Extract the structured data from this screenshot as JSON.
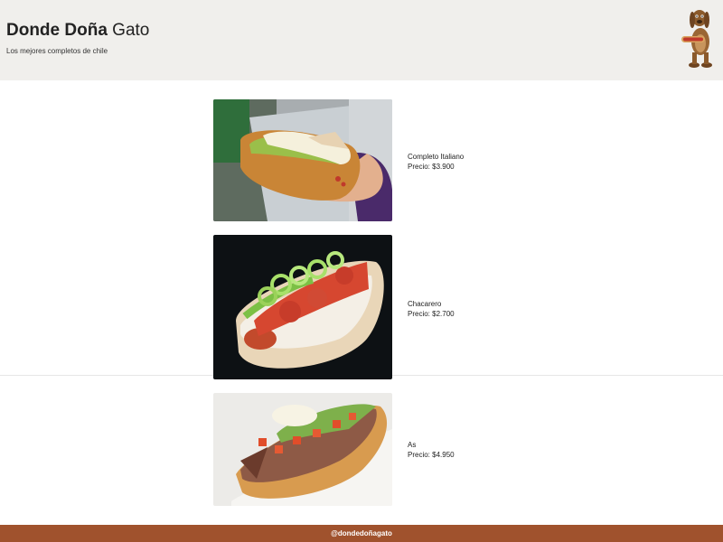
{
  "header": {
    "title_bold": "Donde Doña",
    "title_regular": "Gato",
    "tagline": "Los mejores completos de chile",
    "mascot_icon": "dog-holding-hotdog-icon"
  },
  "menu": {
    "items": [
      {
        "name": "Completo Italiano",
        "price": "Precio: $3.900",
        "image_icon": "completo-italiano-photo"
      },
      {
        "name": "Chacarero",
        "price": "Precio: $2.700",
        "image_icon": "chacarero-photo"
      },
      {
        "name": "As",
        "price": "Precio: $4.950",
        "image_icon": "as-photo"
      }
    ]
  },
  "footer": {
    "handle": "@dondedoñagato"
  },
  "colors": {
    "header_bg": "#f0efec",
    "footer_bg": "#a0522d",
    "footer_text": "#ffffff"
  }
}
